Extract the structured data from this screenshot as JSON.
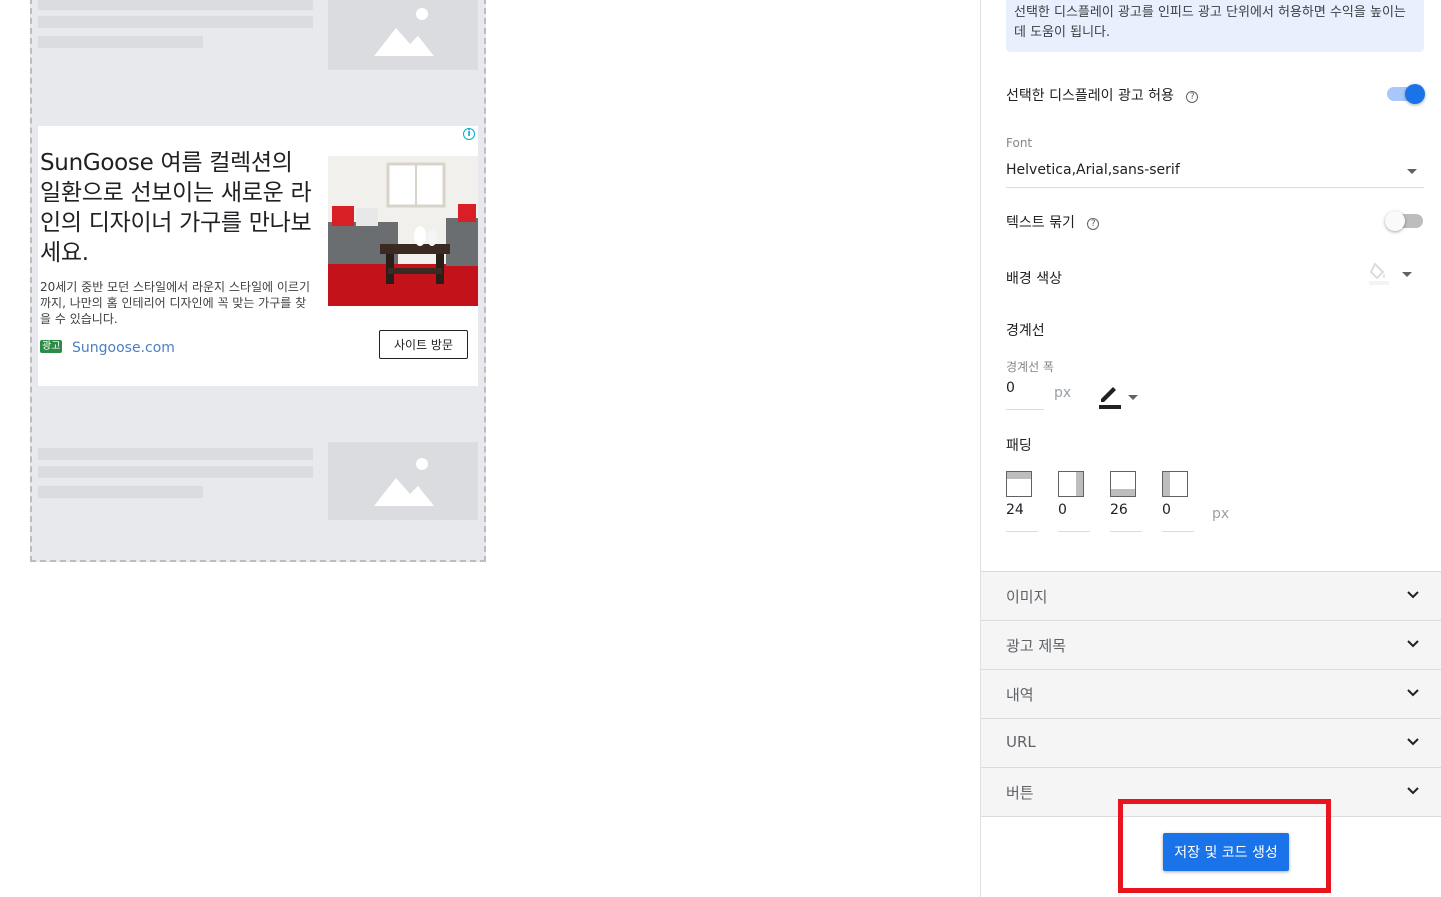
{
  "preview": {
    "ad": {
      "info_icon": "i",
      "headline": "SunGoose 여름 컬렉션의 일환으로 선보이는 새로운 라인의 디자이너 가구를 만나보세요.",
      "description": "20세기 중반 모던 스타일에서 라운지 스타일에 이르기까지, 나만의 홈 인테리어 디자인에 꼭 맞는 가구를 찾을 수 있습니다.",
      "badge": "광고",
      "url": "Sungoose.com",
      "button": "사이트 방문"
    }
  },
  "panel": {
    "info_text": "선택한 디스플레이 광고를 인피드 광고 단위에서 허용하면 수익을 높이는 데 도움이 됩니다.",
    "allow_display_ads": {
      "label": "선택한 디스플레이 광고 허용",
      "help": "?",
      "enabled": true
    },
    "font": {
      "label": "Font",
      "value": "Helvetica,Arial,sans-serif"
    },
    "bold_text": {
      "label": "텍스트 묶기",
      "help": "?",
      "enabled": false
    },
    "background_color": {
      "label": "배경 색상"
    },
    "border": {
      "label": "경계선",
      "width_label": "경계선 폭",
      "width_value": "0",
      "unit": "px"
    },
    "padding": {
      "label": "패딩",
      "top": "24",
      "right": "0",
      "bottom": "26",
      "left": "0",
      "unit": "px"
    },
    "sections": [
      "이미지",
      "광고 제목",
      "내역",
      "URL",
      "버튼"
    ],
    "save_button": "저장 및 코드 생성"
  },
  "colors": {
    "accent": "#1a73e8",
    "highlight": "#e8141e",
    "ad_badge": "#2e8b47",
    "ad_url": "#4a7fc4"
  }
}
